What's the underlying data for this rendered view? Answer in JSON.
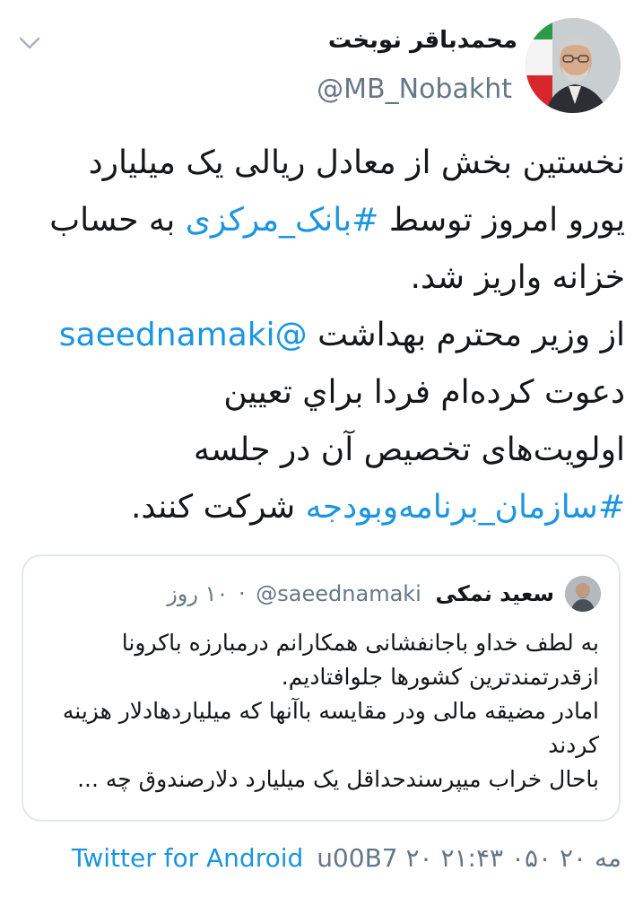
{
  "author": {
    "name": "محمدباقر نوبخت",
    "handle": "@MB_Nobakht"
  },
  "tweet": {
    "lines": [
      [
        {
          "text": "نخستین بخش از معادل ریالی یک میلیارد",
          "link": false
        }
      ],
      [
        {
          "text": "یورو امروز توسط ",
          "link": false
        },
        {
          "text": "#بانک_مرکزی",
          "link": true
        },
        {
          "text": " به حساب",
          "link": false
        }
      ],
      [
        {
          "text": "خزانه واریز شد.",
          "link": false
        }
      ],
      [
        {
          "text": "از وزیر محترم بهداشت ",
          "link": false
        },
        {
          "text": "@saeednamaki",
          "link": true
        }
      ],
      [
        {
          "text": "دعوت کرده‌ام فردا براي تعيين",
          "link": false
        }
      ],
      [
        {
          "text": "اولویت‌های تخصیص آن در جلسه",
          "link": false
        }
      ],
      [
        {
          "text": "#سازمان_برنامه‌وبودجه",
          "link": true
        },
        {
          "text": " شرکت کنند.",
          "link": false
        }
      ]
    ]
  },
  "quote": {
    "name": "سعید نمکی",
    "handle": "@saeednamaki",
    "time": "۱۰ روز",
    "lines": [
      "به لطف خداو باجانفشانی همکارانم درمبارزه باکرونا",
      "ازقدرتمندترین کشورها جلوافتادیم.",
      "امادر مضیقه مالی ودر مقایسه باآنها که میلیاردهادلار هزینه",
      "کردند",
      "باحال خراب میپرسندحداقل یک میلیارد دلارصندوق چه ..."
    ]
  },
  "footer": {
    "source": "Twitter for Android",
    "timestamp": "u00B7 ۲۰ مه ۲۰ ۰۵۰ ۲۱:۴۳"
  },
  "colors": {
    "link": "#1b95e0",
    "secondary": "#657786",
    "border": "#e1e8ed"
  },
  "icons": [
    "chevron-down-icon"
  ]
}
